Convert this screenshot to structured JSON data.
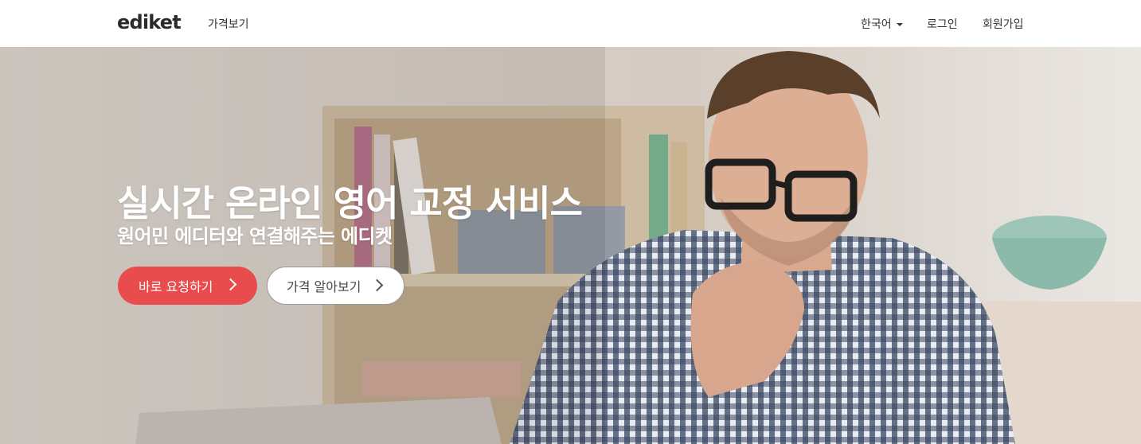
{
  "nav": {
    "logo": "ediket",
    "pricing": "가격보기",
    "language": "한국어",
    "login": "로그인",
    "signup": "회원가입"
  },
  "hero": {
    "title": "실시간 온라인 영어 교정 서비스",
    "subtitle": "원어민 에디터와 연결해주는 에디켓",
    "primary_button": "바로 요청하기",
    "secondary_button": "가격 알아보기"
  },
  "colors": {
    "accent": "#e84c4c",
    "nav_text": "#333333",
    "hero_text": "#ffffff"
  },
  "icons": {
    "primary_button_icon": "chevron-right-icon",
    "secondary_button_icon": "chevron-right-icon",
    "language_icon": "caret-down-icon"
  }
}
